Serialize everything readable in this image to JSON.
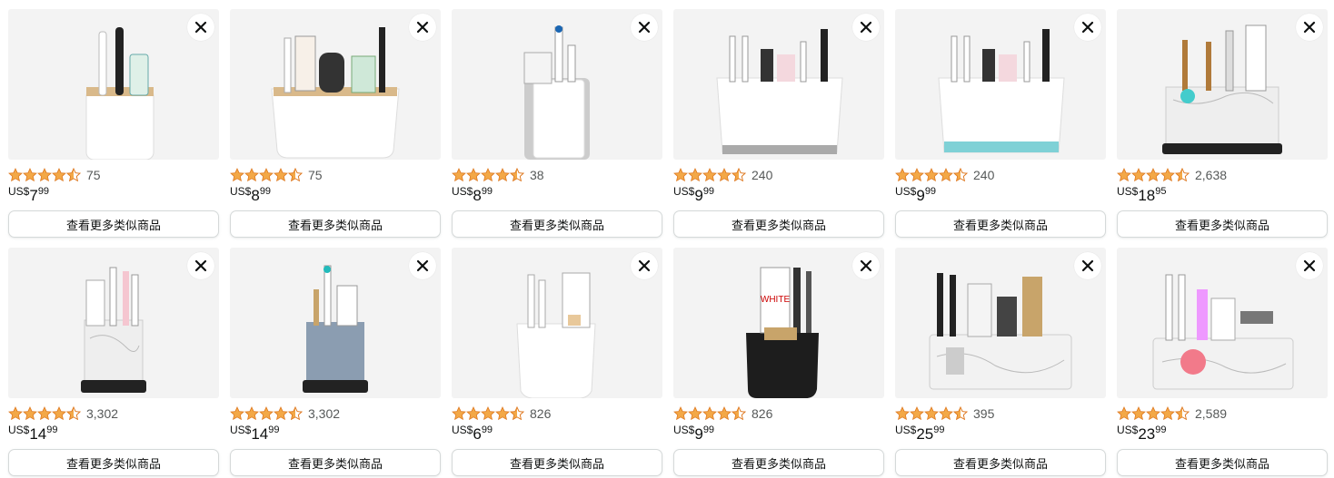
{
  "colors": {
    "star": "#f3a847",
    "star_outline": "#de7921",
    "price": "#0f1111",
    "review_count": "#565959"
  },
  "button_label": "查看更多类似商品",
  "currency": "US$",
  "products": [
    {
      "rating": 4.5,
      "reviews": "75",
      "price_whole": "7",
      "price_frac": "99",
      "image": "white-cup-holder-bamboo-toothbrush"
    },
    {
      "rating": 4.5,
      "reviews": "75",
      "price_whole": "8",
      "price_frac": "99",
      "image": "wide-white-organizer-shaver"
    },
    {
      "rating": 4.5,
      "reviews": "38",
      "price_whole": "8",
      "price_frac": "99",
      "image": "grey-white-square-holder"
    },
    {
      "rating": 4.5,
      "reviews": "240",
      "price_whole": "9",
      "price_frac": "99",
      "image": "white-grey-large-holder"
    },
    {
      "rating": 4.5,
      "reviews": "240",
      "price_whole": "9",
      "price_frac": "99",
      "image": "white-teal-large-holder"
    },
    {
      "rating": 4.5,
      "reviews": "2,638",
      "price_whole": "18",
      "price_frac": "95",
      "image": "marble-organizer-black-base"
    },
    {
      "rating": 4.5,
      "reviews": "3,302",
      "price_whole": "14",
      "price_frac": "99",
      "image": "marble-cup-black-base"
    },
    {
      "rating": 4.5,
      "reviews": "3,302",
      "price_whole": "14",
      "price_frac": "99",
      "image": "blue-stone-cup-black-base"
    },
    {
      "rating": 4.5,
      "reviews": "826",
      "price_whole": "6",
      "price_frac": "99",
      "image": "white-oval-cup"
    },
    {
      "rating": 4.5,
      "reviews": "826",
      "price_whole": "9",
      "price_frac": "99",
      "image": "black-oval-cup-bamboo"
    },
    {
      "rating": 4.5,
      "reviews": "395",
      "price_whole": "25",
      "price_frac": "99",
      "image": "marble-tray-organizer"
    },
    {
      "rating": 4.5,
      "reviews": "2,589",
      "price_whole": "23",
      "price_frac": "99",
      "image": "marble-tray-organizer-pink"
    }
  ]
}
